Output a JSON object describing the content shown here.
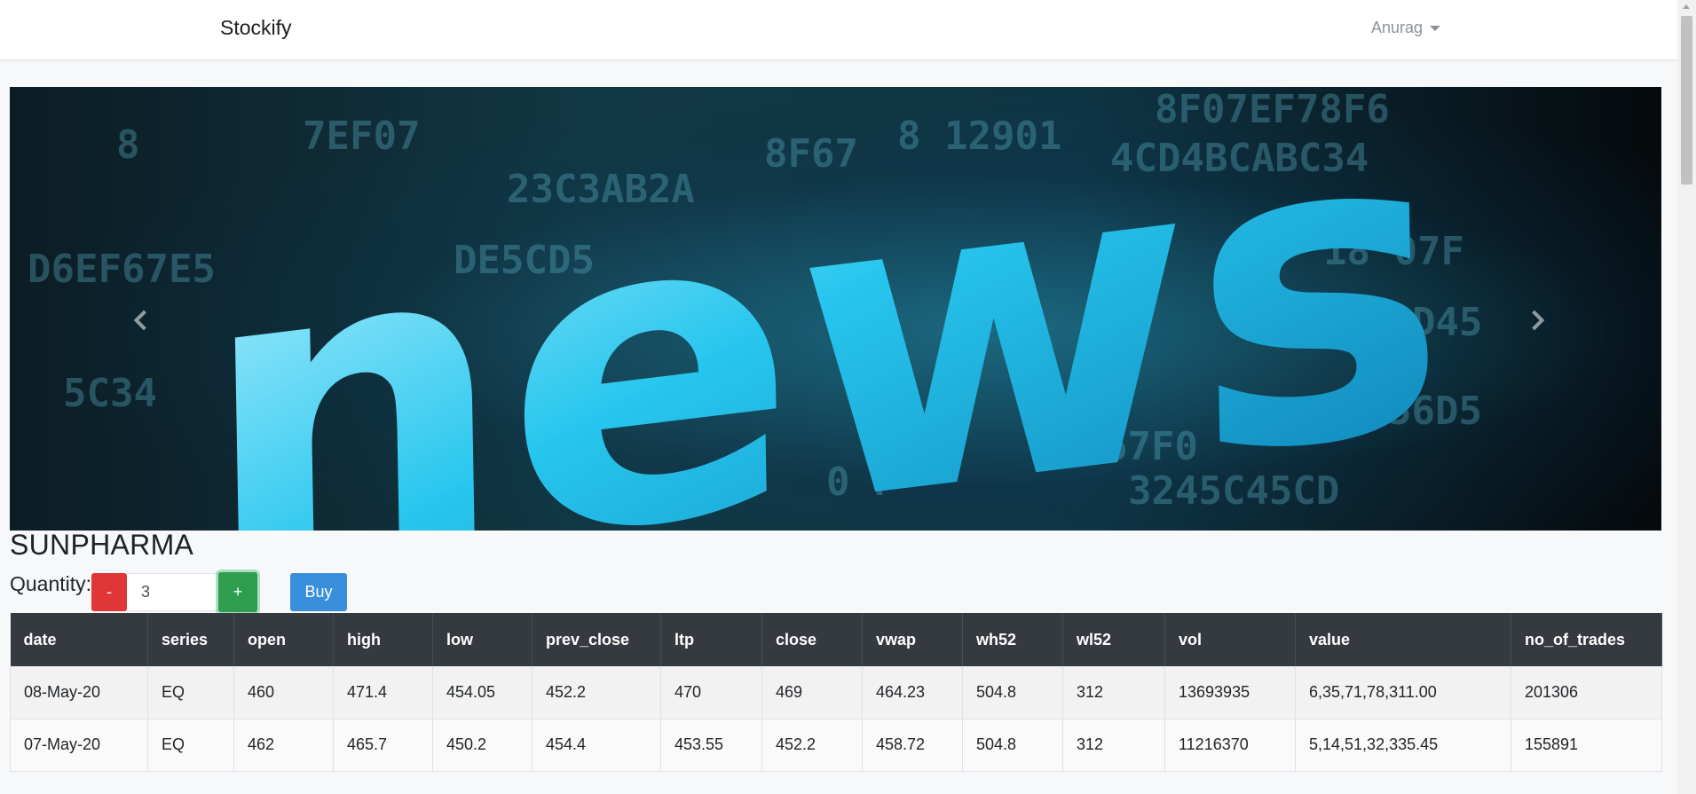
{
  "navbar": {
    "brand": "Stockify",
    "user": "Anurag"
  },
  "carousel": {
    "headline": "news",
    "prev_icon": "chevron-left-icon",
    "next_icon": "chevron-right-icon"
  },
  "stock": {
    "symbol": "SUNPHARMA",
    "quantity_label": "Quantity:",
    "quantity_value": "3",
    "minus_label": "-",
    "plus_label": "+",
    "buy_label": "Buy"
  },
  "table": {
    "columns": [
      "date",
      "series",
      "open",
      "high",
      "low",
      "prev_close",
      "ltp",
      "close",
      "vwap",
      "wh52",
      "wl52",
      "vol",
      "value",
      "no_of_trades"
    ],
    "rows": [
      [
        "08-May-20",
        "EQ",
        "460",
        "471.4",
        "454.05",
        "452.2",
        "470",
        "469",
        "464.23",
        "504.8",
        "312",
        "13693935",
        "6,35,71,78,311.00",
        "201306"
      ],
      [
        "07-May-20",
        "EQ",
        "462",
        "465.7",
        "450.2",
        "454.4",
        "453.55",
        "452.2",
        "458.72",
        "504.8",
        "312",
        "11216370",
        "5,14,51,32,335.45",
        "155891"
      ]
    ]
  },
  "colors": {
    "danger": "#e03636",
    "success": "#2e9d4f",
    "primary": "#3a8fdc",
    "table_header": "#343a40"
  }
}
